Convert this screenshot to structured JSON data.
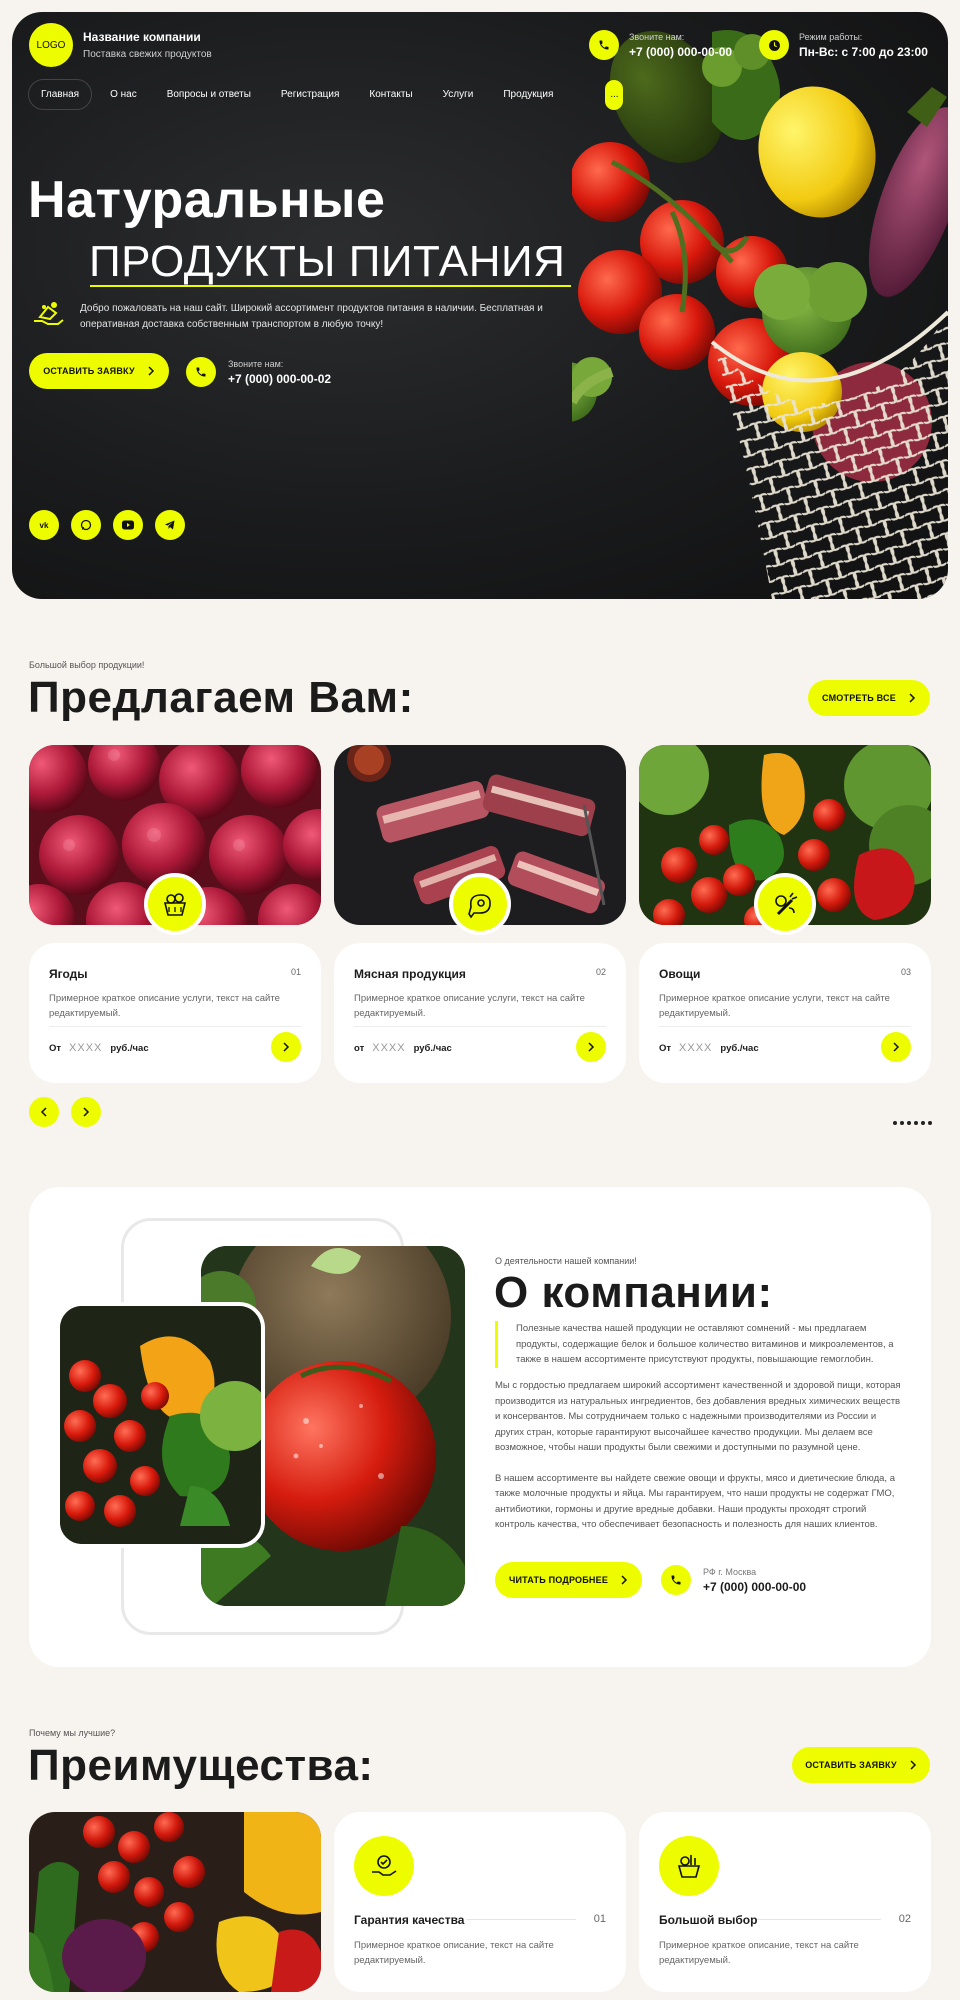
{
  "header": {
    "logo": "LOGO",
    "company_name": "Название компании",
    "company_sub": "Поставка свежих продуктов",
    "phone_label": "Звоните нам:",
    "phone": "+7 (000) 000-00-00",
    "hours_label": "Режим работы:",
    "hours": "Пн-Вс: с 7:00 до 23:00"
  },
  "nav": {
    "items": [
      "Главная",
      "О нас",
      "Вопросы и ответы",
      "Регистрация",
      "Контакты",
      "Услуги",
      "Продукция"
    ],
    "more": "..."
  },
  "hero": {
    "title_line1": "Натуральные",
    "title_line2": "ПРОДУКТЫ ПИТАНИЯ",
    "description": "Добро пожаловать на наш сайт. Широкий ассортимент продуктов питания в наличии. Бесплатная и оперативная доставка собственным транспортом в любую точку!",
    "cta": "ОСТАВИТЬ ЗАЯВКУ",
    "call_label": "Звоните нам:",
    "call_phone": "+7 (000) 000-00-02",
    "socials": [
      "vk",
      "wa",
      "yt",
      "tg"
    ]
  },
  "offer": {
    "kicker": "Большой выбор продукции!",
    "title": "Предлагаем Вам:",
    "see_all": "СМОТРЕТЬ ВСЕ",
    "card_text": "Примерное краткое описание услуги, текст на сайте редактируемый.",
    "cards": [
      {
        "title": "Ягоды",
        "num": "01",
        "price_prefix": "От",
        "price_value": "XXXX",
        "price_unit": "руб./час"
      },
      {
        "title": "Мясная продукция",
        "num": "02",
        "price_prefix": "от",
        "price_value": "XXXX",
        "price_unit": "руб./час"
      },
      {
        "title": "Овощи",
        "num": "03",
        "price_prefix": "От",
        "price_value": "XXXX",
        "price_unit": "руб./час"
      }
    ]
  },
  "about": {
    "kicker": "О деятельности нашей компании!",
    "title": "О компании:",
    "quote": "Полезные качества нашей продукции не оставляют сомнений - мы предлагаем продукты, содержащие белок и большое количество витаминов и микроэлементов, а также в нашем ассортименте присутствуют продукты, повышающие гемоглобин.",
    "p1": "Мы с гордостью предлагаем широкий ассортимент качественной и здоровой пищи, которая производится из натуральных ингредиентов, без добавления вредных химических веществ и консервантов. Мы сотрудничаем только с надежными производителями из России и других стран, которые гарантируют высочайшее качество продукции. Мы делаем все возможное, чтобы наши продукты были свежими и доступными по разумной цене.",
    "p2": "В нашем ассортименте вы найдете свежие овощи и фрукты, мясо и диетические блюда, а также молочные продукты и яйца. Мы гарантируем, что наши продукты не содержат ГМО, антибиотики, гормоны и другие вредные добавки. Наши продукты проходят строгий контроль качества, что обеспечивает безопасность и полезность для наших клиентов.",
    "read_more": "ЧИТАТЬ ПОДРОБНЕЕ",
    "city": "РФ г. Москва",
    "phone": "+7 (000) 000-00-00"
  },
  "advantages": {
    "kicker": "Почему мы лучшие?",
    "title": "Преимущества:",
    "cta": "ОСТАВИТЬ ЗАЯВКУ",
    "cards": [
      {
        "title": "Гарантия качества",
        "num": "01",
        "text": "Примерное краткое описание, текст на сайте редактируемый."
      },
      {
        "title": "Большой выбор",
        "num": "02",
        "text": "Примерное краткое описание, текст на сайте редактируемый."
      }
    ]
  }
}
